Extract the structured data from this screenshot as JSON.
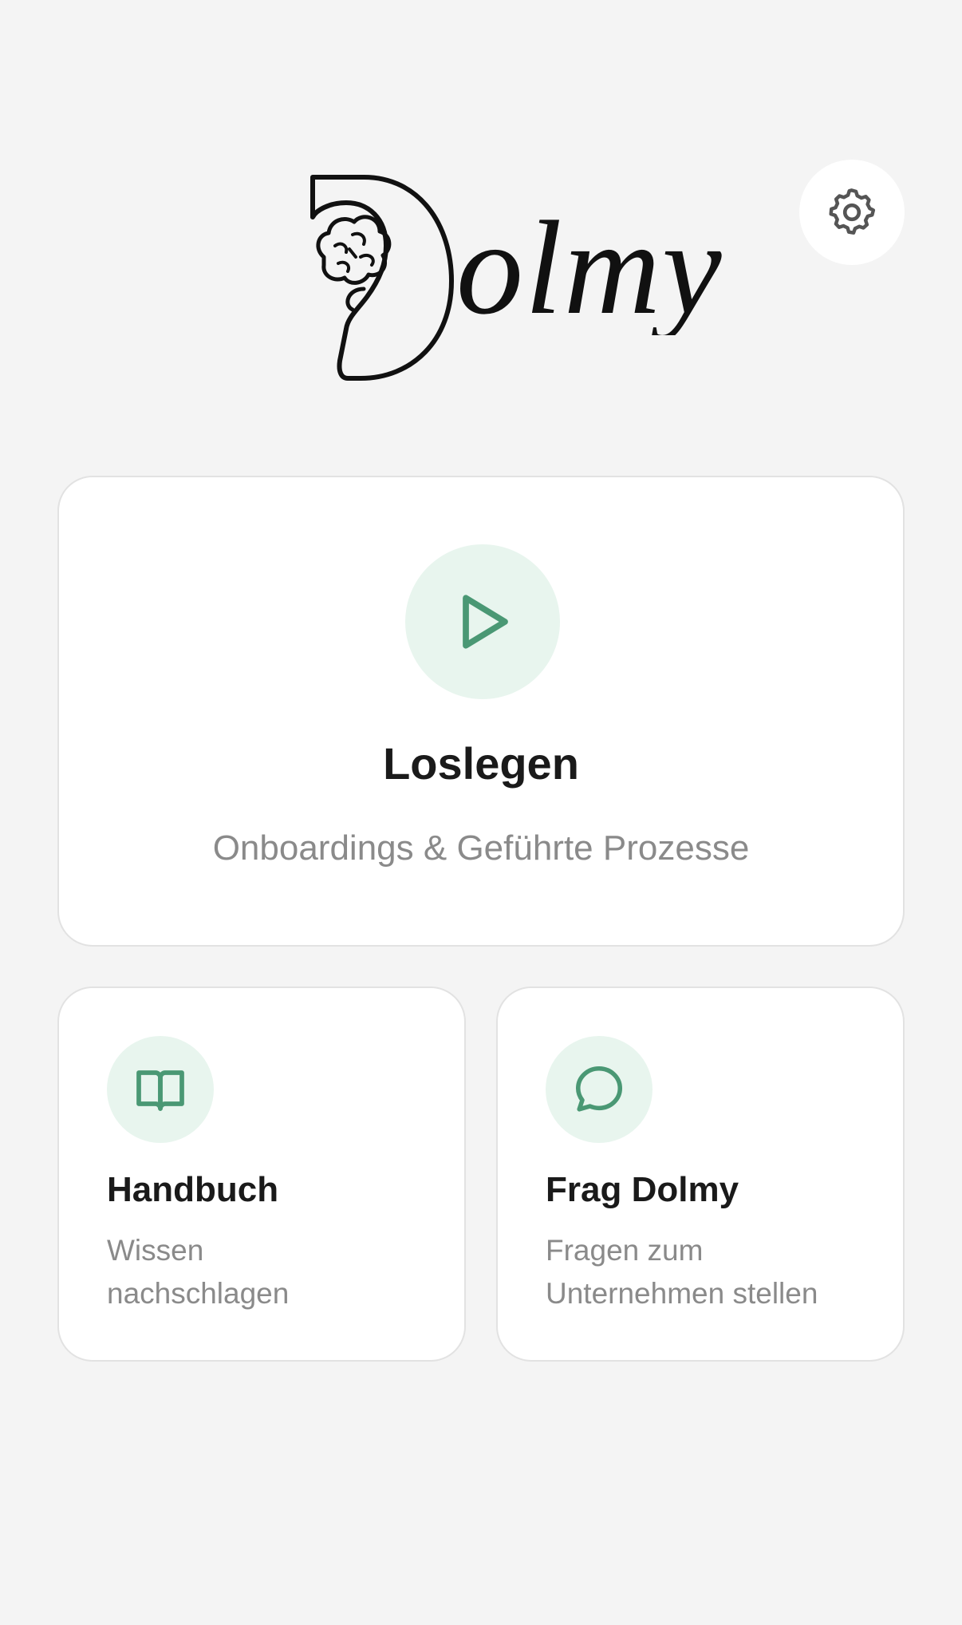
{
  "header": {
    "brand_name": "Dolmy",
    "settings_icon": "gear-icon"
  },
  "main_card": {
    "icon": "play-icon",
    "title": "Loslegen",
    "subtitle": "Onboardings & Geführte Prozesse"
  },
  "cards": [
    {
      "icon": "book-icon",
      "title": "Handbuch",
      "subtitle_line1": "Wissen",
      "subtitle_line2": "nachschlagen"
    },
    {
      "icon": "chat-bubble-icon",
      "title": "Frag Dolmy",
      "subtitle_line1": "Fragen zum",
      "subtitle_line2": "Unternehmen stellen"
    }
  ],
  "colors": {
    "background": "#f4f4f4",
    "card": "#ffffff",
    "accent": "#4a9874",
    "accent_soft": "#e8f5ee"
  }
}
